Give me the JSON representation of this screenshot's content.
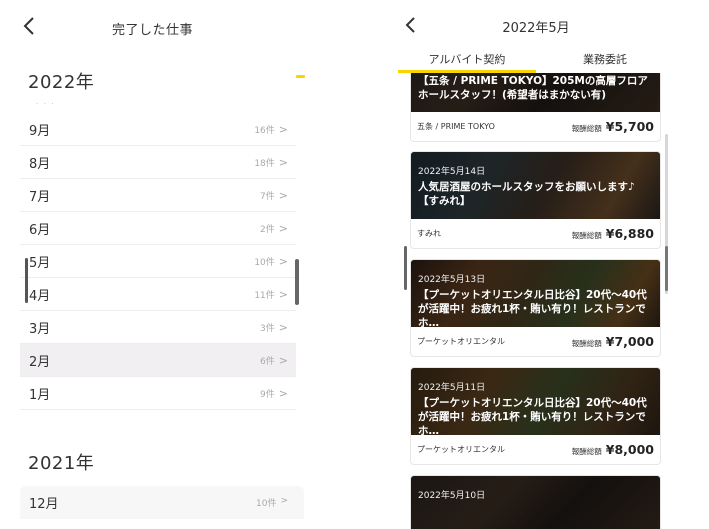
{
  "left": {
    "title": "完了した仕事",
    "years": [
      {
        "label": "2022年",
        "months": [
          {
            "label": "9月",
            "count": "16件"
          },
          {
            "label": "8月",
            "count": "18件"
          },
          {
            "label": "7月",
            "count": "7件"
          },
          {
            "label": "6月",
            "count": "2件"
          },
          {
            "label": "5月",
            "count": "10件"
          },
          {
            "label": "4月",
            "count": "11件"
          },
          {
            "label": "3月",
            "count": "3件"
          },
          {
            "label": "2月",
            "count": "6件"
          },
          {
            "label": "1月",
            "count": "9件"
          }
        ]
      },
      {
        "label": "2021年",
        "months": [
          {
            "label": "12月",
            "count": "10件"
          }
        ]
      }
    ],
    "selected_month": "2月",
    "chevron": ">"
  },
  "right": {
    "title": "2022年5月",
    "tabs": [
      {
        "label": "アルバイト契約",
        "active": true
      },
      {
        "label": "業務委託",
        "active": false
      }
    ],
    "accent": "#f6d500",
    "pay_label": "報酬総額",
    "jobs": [
      {
        "date": "",
        "title": "【五条 / PRIME TOKYO】205Mの高層フロアホールスタッフ！(希望者はまかない有)",
        "company": "五条 / PRIME TOKYO",
        "amount": "¥5,700"
      },
      {
        "date": "2022年5月14日",
        "title": "人気居酒屋のホールスタッフをお願いします♪【すみれ】",
        "company": "すみれ",
        "amount": "¥6,880"
      },
      {
        "date": "2022年5月13日",
        "title": "【プーケットオリエンタル日比谷】20代～40代が活躍中！お疲れ1杯・賄い有り！レストランでホ…",
        "company": "プーケットオリエンタル",
        "amount": "¥7,000"
      },
      {
        "date": "2022年5月11日",
        "title": "【プーケットオリエンタル日比谷】20代～40代が活躍中！お疲れ1杯・賄い有り！レストランでホ…",
        "company": "プーケットオリエンタル",
        "amount": "¥8,000"
      },
      {
        "date": "2022年5月10日",
        "title": "",
        "company": "",
        "amount": ""
      }
    ]
  }
}
